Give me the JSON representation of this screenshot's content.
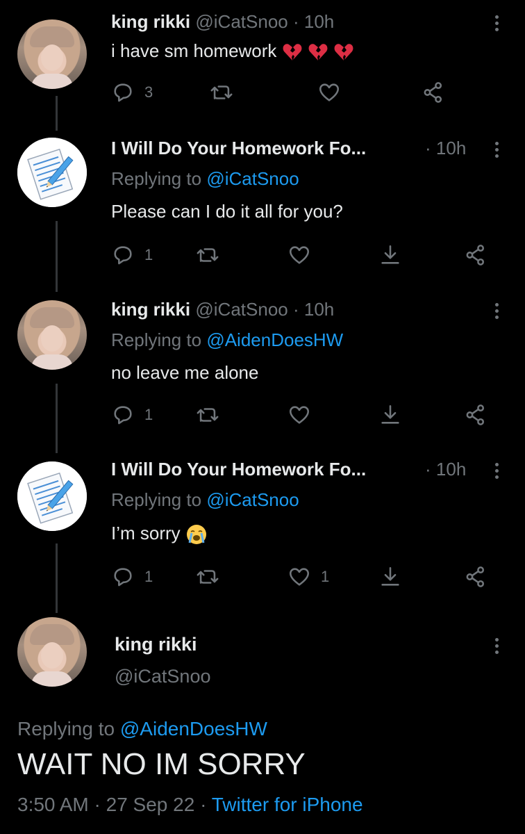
{
  "tweets": [
    {
      "name": "king rikki",
      "handle": "@iCatSnoo",
      "sep": "·",
      "time": "10h",
      "text": "i have sm homework",
      "emoji": [
        "broken-heart",
        "broken-heart",
        "broken-heart"
      ],
      "replies": "3",
      "likes": "",
      "actions": [
        "reply-icon",
        "retweet-icon",
        "like-icon",
        "share-icon"
      ]
    },
    {
      "name": "I Will Do Your Homework Fo...",
      "sep": "·",
      "time": "10h",
      "replying_label": "Replying to",
      "replying_to": "@iCatSnoo",
      "text": "Please can I do it all for you?",
      "replies": "1",
      "likes": "",
      "actions": [
        "reply-icon",
        "retweet-icon",
        "like-icon",
        "download-icon",
        "share-icon"
      ]
    },
    {
      "name": "king rikki",
      "handle": "@iCatSnoo",
      "sep": "·",
      "time": "10h",
      "replying_label": "Replying to",
      "replying_to": "@AidenDoesHW",
      "text": "no leave me alone",
      "replies": "1",
      "likes": "",
      "actions": [
        "reply-icon",
        "retweet-icon",
        "like-icon",
        "download-icon",
        "share-icon"
      ]
    },
    {
      "name": "I Will Do Your Homework Fo...",
      "sep": "·",
      "time": "10h",
      "replying_label": "Replying to",
      "replying_to": "@iCatSnoo",
      "text": "I’m sorry",
      "emoji": [
        "crying-face"
      ],
      "replies": "1",
      "likes": "1",
      "actions": [
        "reply-icon",
        "retweet-icon",
        "like-icon",
        "download-icon",
        "share-icon"
      ]
    }
  ],
  "main": {
    "name": "king rikki",
    "handle": "@iCatSnoo",
    "replying_label": "Replying to",
    "replying_to": "@AidenDoesHW",
    "text": "WAIT NO IM SORRY",
    "time": "3:50 AM",
    "sep": "·",
    "date": "27 Sep 22",
    "source": "Twitter for iPhone"
  },
  "colors": {
    "background": "#000000",
    "text": "#e7e9ea",
    "secondary": "#71767b",
    "accent": "#1d9bf0",
    "heart_red": "#f91880"
  }
}
